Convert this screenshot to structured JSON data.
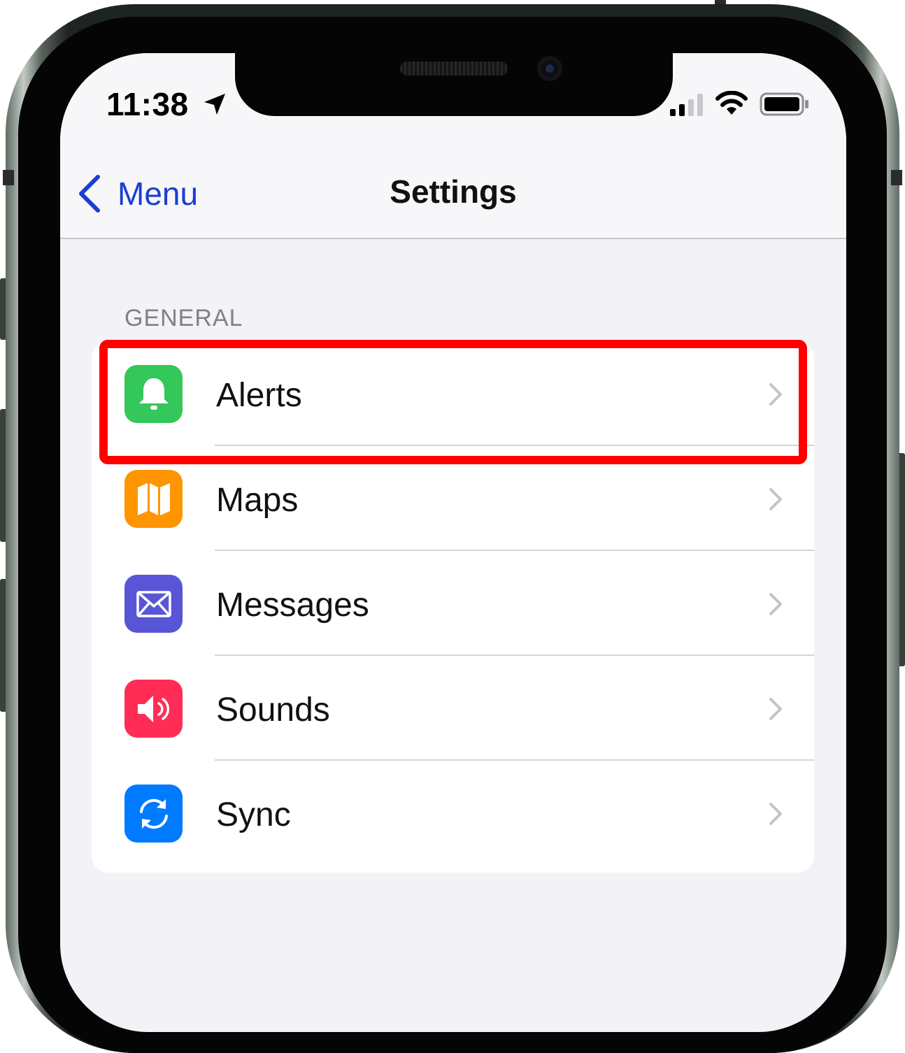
{
  "status_bar": {
    "time": "11:38"
  },
  "nav": {
    "back_label": "Menu",
    "title": "Settings"
  },
  "section": {
    "header": "GENERAL"
  },
  "rows": [
    {
      "label": "Alerts",
      "icon": "bell-icon",
      "color": "#34c759"
    },
    {
      "label": "Maps",
      "icon": "map-icon",
      "color": "#ff9500"
    },
    {
      "label": "Messages",
      "icon": "envelope-icon",
      "color": "#5856d6"
    },
    {
      "label": "Sounds",
      "icon": "speaker-icon",
      "color": "#ff2d55"
    },
    {
      "label": "Sync",
      "icon": "sync-icon",
      "color": "#007aff"
    }
  ],
  "colors": {
    "accent": "#1a3fd1",
    "highlight": "#ff0000",
    "background": "#f2f2f7"
  },
  "highlighted_row": "Alerts"
}
